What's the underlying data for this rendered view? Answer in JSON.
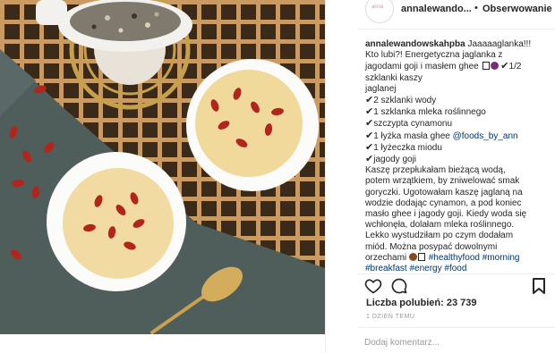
{
  "post": {
    "username": "annalewando...",
    "dot": "•",
    "follow_label": "Obserwowanie",
    "avatar_icon": "profile-avatar",
    "caption": {
      "author": "annalewandowskahpba",
      "l1": "Jaaaaaglanka!!!",
      "l2": "Kto lubi?! Energetyczna jaglanka z",
      "l3a": "jagodami goji i masłem ghee",
      "l3b": "1/2",
      "l4": "szklanki kaszy",
      "l5": "jaglanej",
      "l6": "2 szklanki wody",
      "l7": "1 szklanka mleka roślinnego",
      "l8": "szczypta cynamonu",
      "l9a": "1 łyżka masła ghee",
      "l9b": "@foods_by_ann",
      "l10": "1 łyżeczka miodu",
      "l11": "jagody goji",
      "l12": "Kaszę przepłukałam bieżącą wodą,",
      "l13": "potem wrzątkiem, by zniwelować smak",
      "l14": "goryczki. Ugotowałam kaszę jaglaną na",
      "l15": "wodzie dodając cynamon, a pod koniec",
      "l16": "masło ghee i jagody goji. Kiedy woda się",
      "l17": "wchłonęła, dolałam mleka roślinnego.",
      "l18": "Lekko wystudziłam po czym dodałam",
      "l19": "miód. Można posypać dowolnymi",
      "l20a": "orzechami",
      "l20b": "#healthyfood #morning",
      "l21": "#breakfast #energy #food",
      "check": "✔"
    },
    "likes": "Liczba polubień: 23 739",
    "date": "1 DZIEŃ TEMU",
    "comment_placeholder": "Dodaj komentarz...",
    "icons": {
      "like": "heart-icon",
      "comment": "comment-icon",
      "save": "bookmark-icon"
    },
    "colors": {
      "text": "#262626",
      "link": "#003569",
      "muted": "#999999",
      "divider": "#efefef"
    }
  }
}
